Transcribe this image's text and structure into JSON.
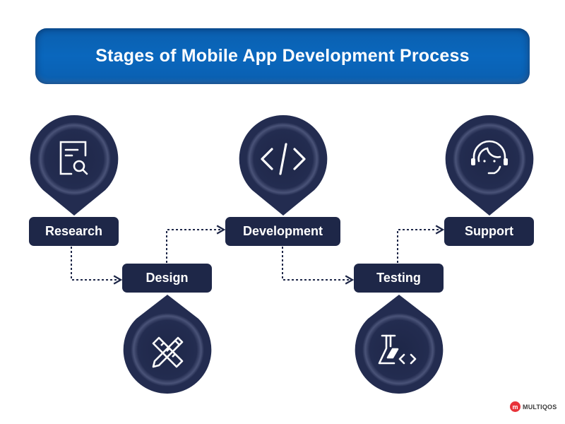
{
  "title": "Stages of Mobile App Development Process",
  "stages": [
    {
      "label": "Research",
      "icon": "document-search-icon",
      "pin": "above"
    },
    {
      "label": "Design",
      "icon": "ruler-pencil-icon",
      "pin": "below"
    },
    {
      "label": "Development",
      "icon": "code-icon",
      "pin": "above"
    },
    {
      "label": "Testing",
      "icon": "flask-code-icon",
      "pin": "below"
    },
    {
      "label": "Support",
      "icon": "headset-support-icon",
      "pin": "above"
    }
  ],
  "colors": {
    "banner": "#0a67bd",
    "node": "#1e2748",
    "text": "#ffffff",
    "connector": "#1e2748",
    "logo_accent": "#e8333a"
  },
  "logo": {
    "mark": "m",
    "text": "MULTIQOS"
  }
}
